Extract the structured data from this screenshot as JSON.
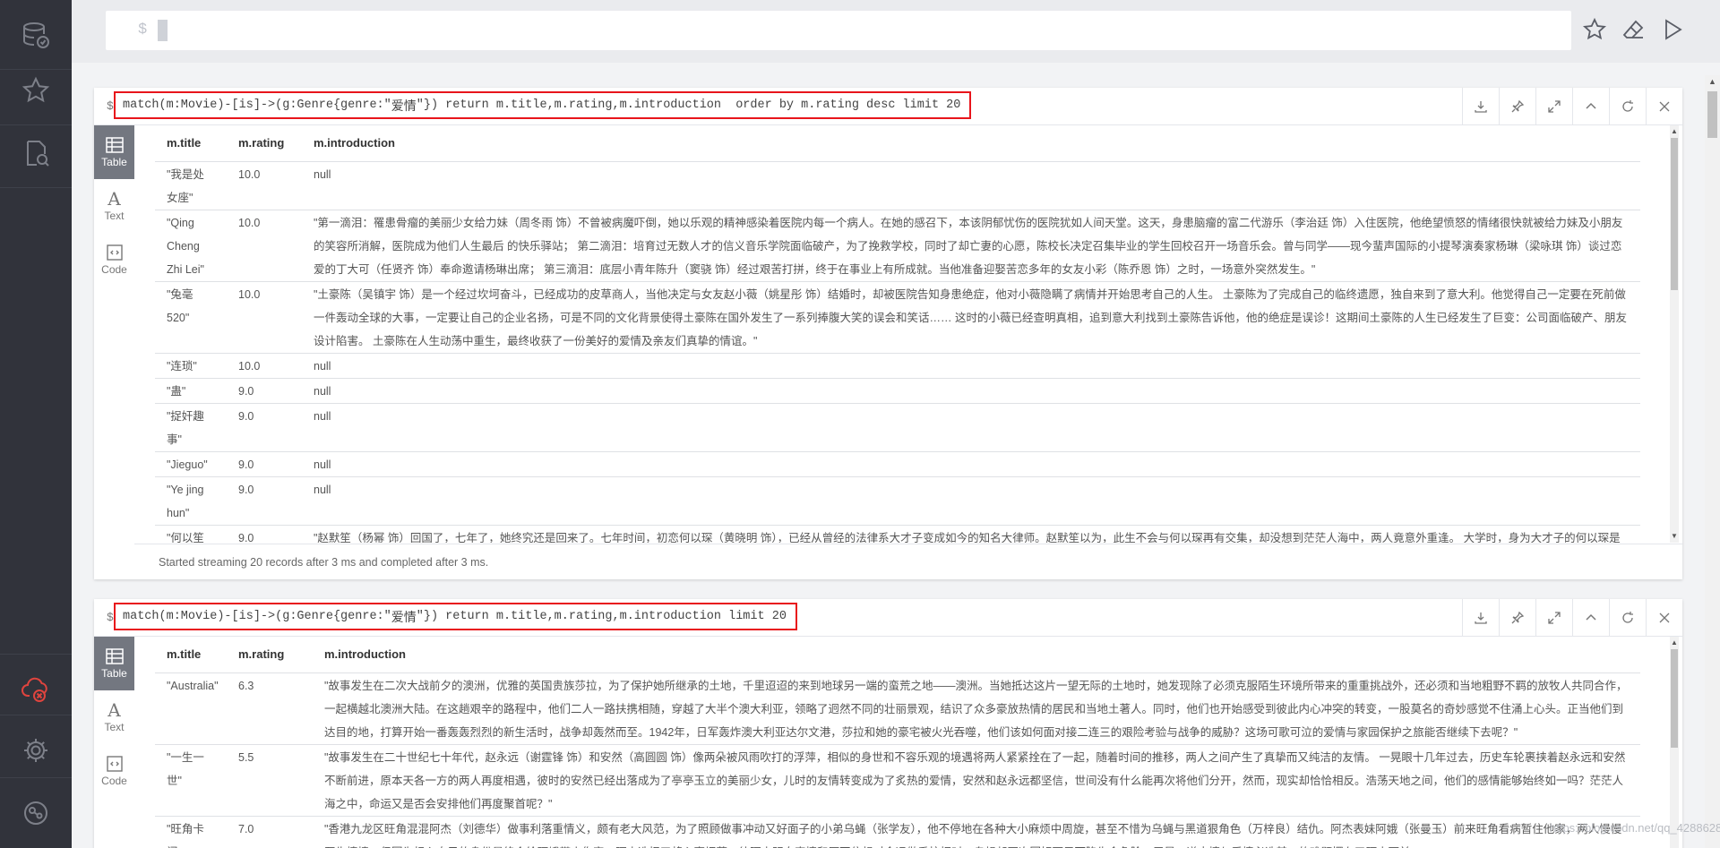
{
  "editor": {
    "prompt": "$"
  },
  "frames": [
    {
      "dollar": "$",
      "query_pre": "match(m:Movie)-[is]->(g:Genre{genre:\"",
      "query_genre": "爱情",
      "query_post": "\"}) return m.title,m.rating,m.introduction  order by m.rating desc limit 20",
      "tabs": [
        "Table",
        "Text",
        "Code"
      ],
      "columns": [
        "m.title",
        "m.rating",
        "m.introduction"
      ],
      "rows": [
        {
          "title": "\"我是处女座\"",
          "rating": "10.0",
          "intro": "null"
        },
        {
          "title": "\"Qing Cheng Zhi Lei\"",
          "rating": "10.0",
          "intro": "\"第一滴泪：罹患骨瘤的美丽少女给力妹（周冬雨 饰）不曾被病魔吓倒，她以乐观的精神感染着医院内每一个病人。在她的感召下，本该阴郁忧伤的医院犹如人间天堂。这天，身患脑瘤的富二代游乐（李治廷 饰）入住医院，他绝望愤怒的情绪很快就被给力妹及小朋友的笑容所消解，医院成为他们人生最后 的快乐驿站；        第二滴泪：培育过无数人才的信义音乐学院面临破产，为了挽救学校，同时了却亡妻的心愿，陈校长决定召集毕业的学生回校召开一场音乐会。曾与同学——现今蜚声国际的小提琴演奏家杨琳（梁咏琪 饰）谈过恋爱的丁大可（任贤齐 饰）奉命邀请杨琳出席；        第三滴泪：底层小青年陈升（窦骁 饰）经过艰苦打拼，终于在事业上有所成就。当他准备迎娶苦恋多年的女友小彩（陈乔恩 饰）之时，一场意外突然发生。\""
        },
        {
          "title": "\"兔毫520\"",
          "rating": "10.0",
          "intro": "\"土豪陈（吴镇宇 饰）是一个经过坎坷奋斗，已经成功的皮草商人，当他决定与女友赵小薇（姚星彤 饰）结婚时，却被医院告知身患绝症，他对小薇隐瞒了病情并开始思考自己的人生。        土豪陈为了完成自己的临终遗愿，独自来到了意大利。他觉得自己一定要在死前做一件轰动全球的大事，一定要让自己的企业名扬，可是不同的文化背景使得土豪陈在国外发生了一系列捧腹大笑的误会和笑话……        这时的小薇已经查明真相，追到意大利找到土豪陈告诉他，他的绝症是误诊！这期间土豪陈的人生已经发生了巨变：公司面临破产、朋友设计陷害。        土豪陈在人生动荡中重生，最终收获了一份美好的爱情及亲友们真挚的情谊。\""
        },
        {
          "title": "\"连琐\"",
          "rating": "10.0",
          "intro": "null"
        },
        {
          "title": "\"蛊\"",
          "rating": "9.0",
          "intro": "null"
        },
        {
          "title": "\"捉奸趣事\"",
          "rating": "9.0",
          "intro": "null"
        },
        {
          "title": "\"Jieguo\"",
          "rating": "9.0",
          "intro": "null"
        },
        {
          "title": "\"Ye jing hun\"",
          "rating": "9.0",
          "intro": "null"
        },
        {
          "title": "\"何以笙箫默\"",
          "rating": "9.0",
          "intro": "\"赵默笙（杨幂 饰）回国了，七年了，她终究还是回来了。七年时间，初恋何以琛（黄晓明 饰），已经从曾经的法律系大才子变成如今的知名大律师。赵默笙以为，此生不会与何以琛再有交集，却没想到茫茫人海中，两人竟意外重逢。        大学时，身为大才子的何以琛是校园里无数女生的梦中情人，赵默笙对他一见钟情，展开了疯狂的追求，两人终于在一起，却因为误会与家庭阻碍被迫分开……\""
        }
      ],
      "status": "Started streaming 20 records after 3 ms and completed after 3 ms."
    },
    {
      "dollar": "$",
      "query_pre": "match(m:Movie)-[is]->(g:Genre{genre:\"",
      "query_genre": "爱情",
      "query_post": "\"}) return m.title,m.rating,m.introduction limit 20",
      "tabs": [
        "Table",
        "Text",
        "Code"
      ],
      "columns": [
        "m.title",
        "m.rating",
        "m.introduction"
      ],
      "rows": [
        {
          "title": "\"Australia\"",
          "rating": "6.3",
          "intro": "\"故事发生在二次大战前夕的澳洲，优雅的英国贵族莎拉，为了保护她所继承的土地，千里迢迢的来到地球另一端的蛮荒之地——澳洲。当她抵达这片一望无际的土地时，她发现除了必须克服陌生环境所带来的重重挑战外，还必须和当地粗野不羁的放牧人共同合作，一起横越北澳洲大陆。在这趟艰辛的路程中，他们二人一路扶携相随，穿越了大半个澳大利亚，领略了迥然不同的壮丽景观，结识了众多豪放热情的居民和当地土著人。同时，他们也开始感受到彼此内心冲突的转变，一股莫名的奇妙感觉不住涌上心头。正当他们到达目的地，打算开始一番轰轰烈烈的新生活时，战争却轰然而至。1942年，日军轰炸澳大利亚达尔文港，莎拉和她的豪宅被火光吞噬，他们该如何面对接二连三的艰险考验与战争的威胁？这场可歌可泣的爱情与家园保护之旅能否继续下去呢？\""
        },
        {
          "title": "\"一生一世\"",
          "rating": "5.5",
          "intro": "\"故事发生在二十世纪七十年代，赵永远（谢霆锋 饰）和安然（高圆圆 饰）像两朵被风雨吹打的浮萍，相似的身世和不容乐观的境遇将两人紧紧拴在了一起，随着时间的推移，两人之间产生了真挚而又纯洁的友情。        一晃眼十几年过去，历史车轮裹挟着赵永远和安然不断前进，原本天各一方的两人再度相遇，彼时的安然已经出落成为了亭亭玉立的美丽少女，儿时的友情转变成为了炙热的爱情，安然和赵永远都坚信，世间没有什么能再次将他们分开，然而，现实却恰恰相反。浩荡天地之间，他们的感情能够始终如一吗？茫茫人海之中，命运又是否会安排他们再度聚首呢？\""
        },
        {
          "title": "\"旺角卡门\"",
          "rating": "7.0",
          "intro": "\"香港九龙区旺角混混阿杰（刘德华）做事利落重情义，颇有老大风范，为了照顾做事冲动又好面子的小弟乌蝇（张学友），他不停地在各种大小麻烦中周旋，甚至不惜为乌蝇与黑道狠角色（万梓良）结仇。阿杰表妹阿娥（张曼玉）前来旺角看病暂住他家，两人慢慢互生情愫，但因为担心自己的身份最终会给阿娥带来伤害，阿杰选择了将心事埋藏。待阿杰明白真情和压不住想对命运做番抗拒时，乌蝇却再次因好面子而陷生命危险，于是一道去情与爱情必选其一的难题摆在了阿杰面前。\""
        }
      ]
    }
  ],
  "watermark": "https://blog.csdn.net/qq_42886289"
}
